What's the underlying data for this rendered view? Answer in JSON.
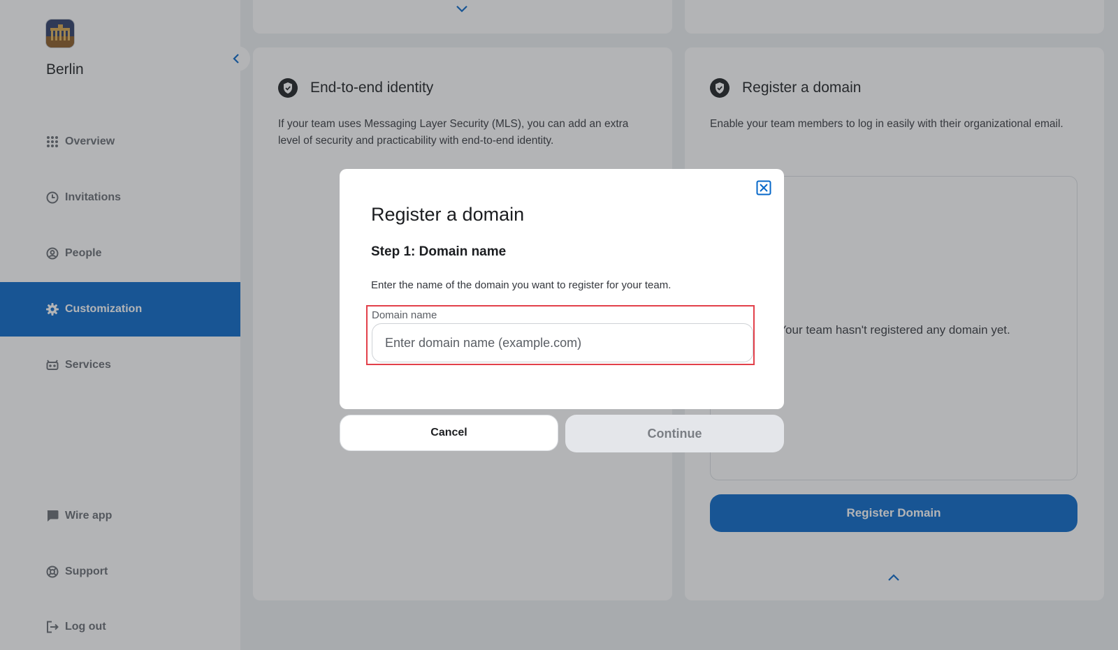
{
  "team": {
    "name": "Berlin"
  },
  "sidebar": {
    "items": [
      {
        "label": "Overview",
        "icon": "grid-icon"
      },
      {
        "label": "Invitations",
        "icon": "clock-icon"
      },
      {
        "label": "People",
        "icon": "user-circle-icon"
      },
      {
        "label": "Customization",
        "icon": "gear-icon",
        "active": true
      },
      {
        "label": "Services",
        "icon": "bot-icon"
      }
    ],
    "bottom_items": [
      {
        "label": "Wire app",
        "icon": "chat-icon"
      },
      {
        "label": "Support",
        "icon": "lifebuoy-icon"
      },
      {
        "label": "Log out",
        "icon": "logout-icon"
      }
    ]
  },
  "cards": {
    "e2ei": {
      "title": "End-to-end identity",
      "description": "If your team uses Messaging Layer Security (MLS), you can add an extra level of security and practicability with end-to-end identity."
    },
    "domain": {
      "title": "Register a domain",
      "description": "Enable your team members to log in easily with their organizational email.",
      "empty_text": "Your team hasn't registered any domain yet.",
      "button_label": "Register Domain"
    }
  },
  "modal": {
    "title": "Register a domain",
    "step": "Step 1: Domain name",
    "description": "Enter the name of the domain you want to register for your team.",
    "field_label": "Domain name",
    "field_value": "",
    "field_placeholder": "Enter domain name (example.com)",
    "cancel_label": "Cancel",
    "continue_label": "Continue"
  },
  "colors": {
    "accent": "#0667c8",
    "highlight_border": "#e2404a",
    "disabled_button": "#e4e6ea"
  }
}
